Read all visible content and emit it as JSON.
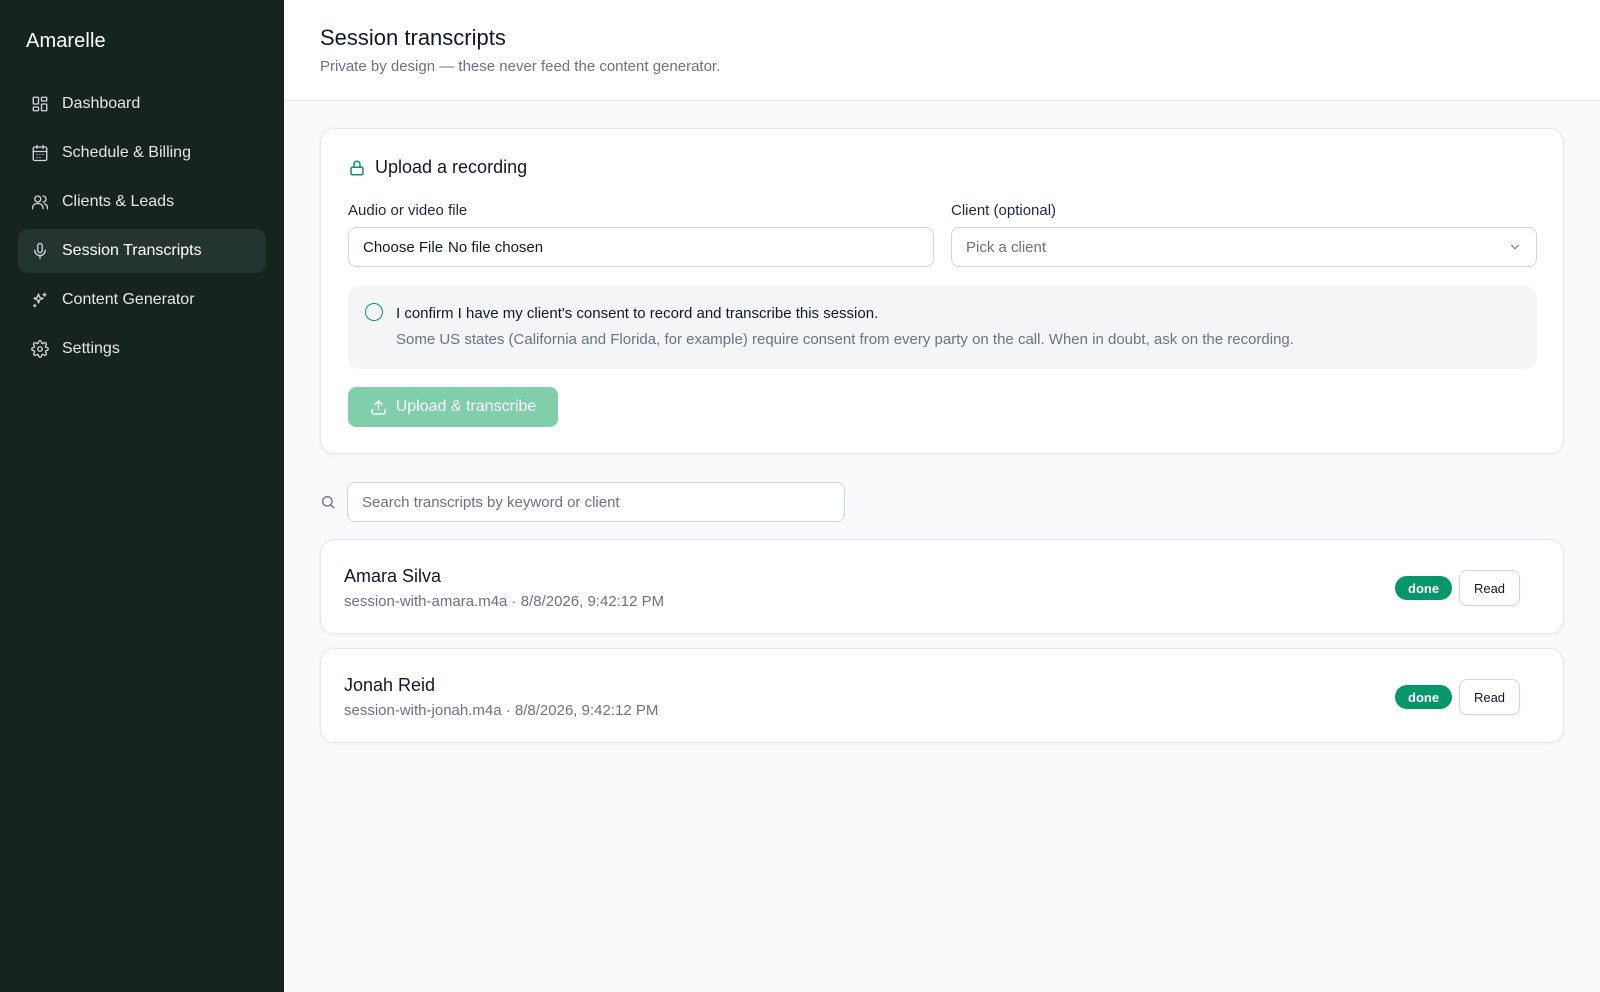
{
  "app": {
    "brand": "Amarelle"
  },
  "sidebar": {
    "items": [
      {
        "label": "Dashboard",
        "icon": "dashboard-icon"
      },
      {
        "label": "Schedule & Billing",
        "icon": "calendar-icon"
      },
      {
        "label": "Clients & Leads",
        "icon": "users-icon"
      },
      {
        "label": "Session Transcripts",
        "icon": "mic-icon",
        "active": true
      },
      {
        "label": "Content Generator",
        "icon": "sparkles-icon"
      },
      {
        "label": "Settings",
        "icon": "gear-icon"
      }
    ]
  },
  "header": {
    "title": "Session transcripts",
    "subtitle": "Private by design — these never feed the content generator."
  },
  "upload": {
    "title": "Upload a recording",
    "file_label": "Audio or video file",
    "file_button": "Choose File",
    "file_status": "No file chosen",
    "client_label": "Client (optional)",
    "client_placeholder": "Pick a client",
    "consent_text": "I confirm I have my client's consent to record and transcribe this session.",
    "consent_note": "Some US states (California and Florida, for example) require consent from every party on the call. When in doubt, ask on the recording.",
    "button_label": "Upload & transcribe"
  },
  "search": {
    "placeholder": "Search transcripts by keyword or client"
  },
  "transcripts": [
    {
      "name": "Amara Silva",
      "meta": "session-with-amara.m4a · 8/8/2026, 9:42:12 PM",
      "status": "done",
      "action": "Read"
    },
    {
      "name": "Jonah Reid",
      "meta": "session-with-jonah.m4a · 8/8/2026, 9:42:12 PM",
      "status": "done",
      "action": "Read"
    }
  ],
  "colors": {
    "sidebar_bg": "#16231f",
    "accent": "#059669",
    "button_disabled": "#7fd0aa"
  }
}
